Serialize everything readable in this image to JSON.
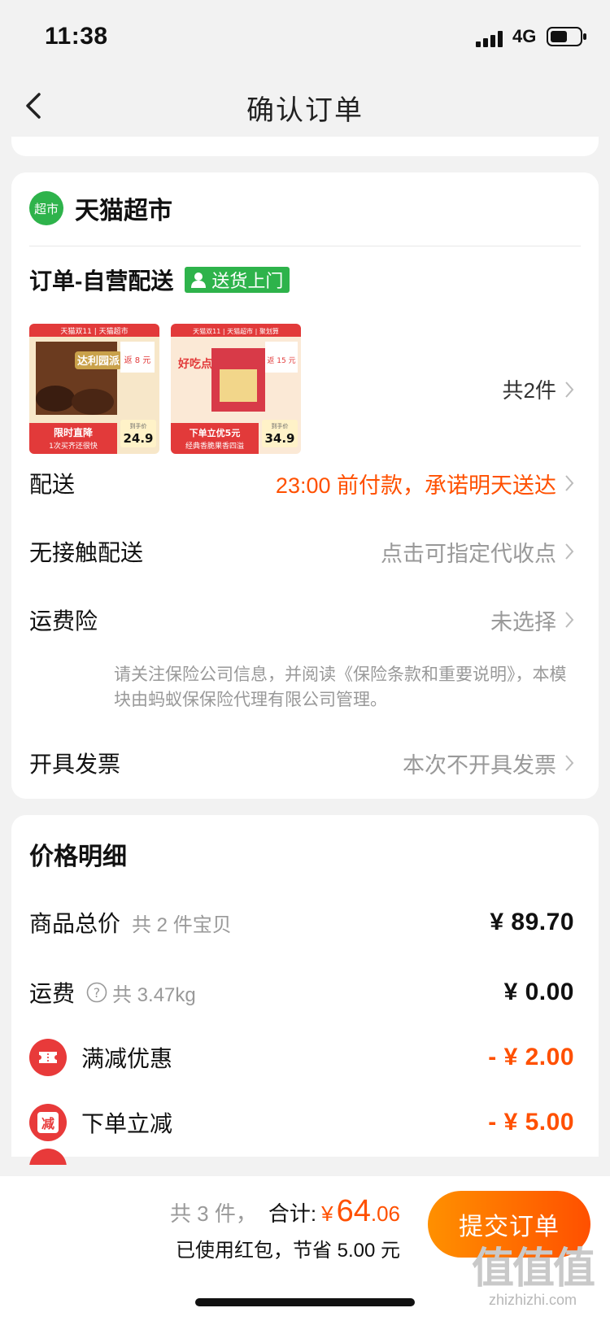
{
  "status_bar": {
    "time": "11:38",
    "network": "4G"
  },
  "nav": {
    "title": "确认订单"
  },
  "store": {
    "badge": "超市",
    "name": "天猫超市"
  },
  "shipping": {
    "title": "订单-自营配送",
    "tag": "送货上门"
  },
  "products": {
    "count_label": "共2件",
    "items": [
      {
        "banner": "天猫双11 | 天猫超市",
        "brand": "达利园派",
        "promo_top": "返 8 元",
        "price_label": "到手价",
        "price": "24.9",
        "bottom_title": "限时直降",
        "bottom_sub": "1次买齐还很快"
      },
      {
        "banner": "天猫双11 | 天猫超市 | 聚划算",
        "brand": "好吃点",
        "promo_top": "返 15 元",
        "price_label": "到手价",
        "price": "34.9",
        "bottom_title": "下单立优5元",
        "bottom_sub": "经典香脆果香四溢"
      }
    ]
  },
  "rows": {
    "delivery": {
      "label": "配送",
      "value": "23:00 前付款，承诺明天送达"
    },
    "contactless": {
      "label": "无接触配送",
      "value": "点击可指定代收点"
    },
    "insurance": {
      "label": "运费险",
      "value": "未选择",
      "note": "请关注保险公司信息，并阅读《保险条款和重要说明》，本模块由蚂蚁保保险代理有限公司管理。"
    },
    "invoice": {
      "label": "开具发票",
      "value": "本次不开具发票"
    }
  },
  "price_detail": {
    "title": "价格明细",
    "goods_total": {
      "label": "商品总价",
      "sub": "共 2 件宝贝",
      "amount": "¥ 89.70"
    },
    "shipping_fee": {
      "label": "运费",
      "sub": "共 3.47kg",
      "amount": "¥ 0.00"
    },
    "discount": {
      "label": "满减优惠",
      "amount": "- ¥ 2.00",
      "icon": "ticket-icon"
    },
    "instant_off": {
      "label": "下单立减",
      "amount": "- ¥ 5.00",
      "icon_text": "减"
    }
  },
  "bottom": {
    "count": "共 3 件，",
    "total_label": "合计:",
    "currency": "¥",
    "total_int": "64",
    "total_dec": ".06",
    "savings": "已使用红包，节省 5.00 元",
    "submit_label": "提交订单"
  },
  "watermark": {
    "logo": "值值值",
    "url": "zhizhizhi.com"
  },
  "colors": {
    "accent": "#ff5000",
    "green": "#2eb34b",
    "red": "#e83a3a"
  }
}
